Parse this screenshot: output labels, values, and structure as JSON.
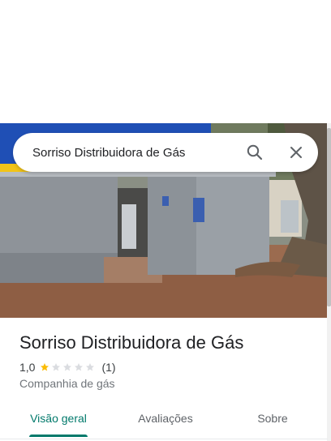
{
  "search": {
    "value": "Sorriso Distribuidora de Gás",
    "search_icon": "search-icon",
    "close_icon": "close-icon"
  },
  "place": {
    "title": "Sorriso Distribuidora de Gás",
    "rating": "1,0",
    "stars_filled": 1,
    "stars_total": 5,
    "review_count": "(1)",
    "category": "Companhia de gás"
  },
  "tabs": [
    {
      "label": "Visão geral",
      "active": true
    },
    {
      "label": "Avaliações",
      "active": false
    },
    {
      "label": "Sobre",
      "active": false
    }
  ],
  "colors": {
    "accent": "#00796b",
    "star_filled": "#fbbc04",
    "star_empty": "#dadce0"
  }
}
